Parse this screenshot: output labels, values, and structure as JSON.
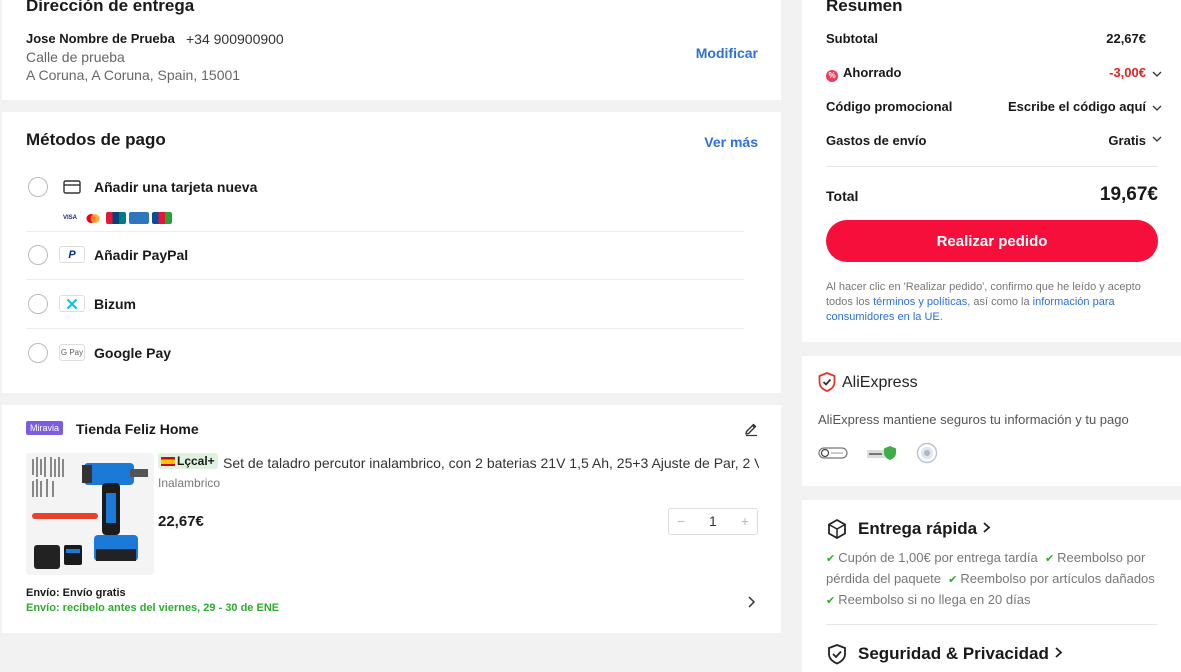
{
  "address": {
    "title": "Dirección de entrega",
    "name": "Jose Nombre de Prueba",
    "phone": "+34 900900900",
    "street": "Calle de prueba",
    "city": "A Coruna, A Coruna, Spain, 15001",
    "modify": "Modificar"
  },
  "payment": {
    "title": "Métodos de pago",
    "see_more": "Ver más",
    "options": [
      {
        "label": "Añadir una tarjeta nueva",
        "icon": "card-icon"
      },
      {
        "label": "Añadir PayPal",
        "icon": "paypal-icon"
      },
      {
        "label": "Bizum",
        "icon": "bizum-icon"
      },
      {
        "label": "Google Pay",
        "icon": "google-pay-icon",
        "logo_text": "G Pay"
      }
    ],
    "card_brands": [
      "VISA",
      "MC",
      "UP",
      "AMEX",
      "JCB"
    ]
  },
  "store": {
    "badge": "Miravia",
    "name": "Tienda Feliz Home",
    "product": {
      "local_badge": "Lçcal+",
      "title": "Set de taladro percutor inalambrico, con 2 baterias 21V 1,5 Ah, 25+3 Ajuste de Par, 2 V",
      "variant": "Inalambrico",
      "price": "22,67€",
      "quantity": "1",
      "minus": "−",
      "plus": "+"
    },
    "shipping": "Envío: Envío gratis",
    "delivery": "Envío: recíbelo antes del viernes, 29 - 30 de ENE"
  },
  "summary": {
    "title": "Resumen",
    "subtotal_label": "Subtotal",
    "subtotal_value": "22,67€",
    "saved_label": "Ahorrado",
    "saved_value": "-3,00€",
    "promo_label": "Código promocional",
    "promo_value": "Escribe el código aquí",
    "shipping_label": "Gastos de envío",
    "shipping_value": "Gratis",
    "total_label": "Total",
    "total_value": "19,67€",
    "order_button": "Realizar pedido",
    "legal_1": "Al hacer clic en 'Realizar pedido', confirmo que he leído y acepto todos los ",
    "legal_link_1": "términos y políticas",
    "legal_2": ", así como la ",
    "legal_link_2": "información para consumidores en la UE",
    "legal_3": "."
  },
  "aliexpress": {
    "brand": "AliExpress",
    "description": "AliExpress mantiene seguros tu información y tu pago"
  },
  "delivery": {
    "title": "Entrega rápida",
    "benefit_1": "Cupón de 1,00€ por entrega tardía",
    "benefit_2": "Reembolso por pérdida del paquete",
    "benefit_3": "Reembolso por artículos dañados",
    "benefit_4": "Reembolso si no llega en 20 días",
    "security_title": "Seguridad & Privacidad"
  },
  "colors": {
    "accent_red": "#f50f3a",
    "link_blue": "#2e6fd8",
    "success_green": "#2eab2e"
  }
}
